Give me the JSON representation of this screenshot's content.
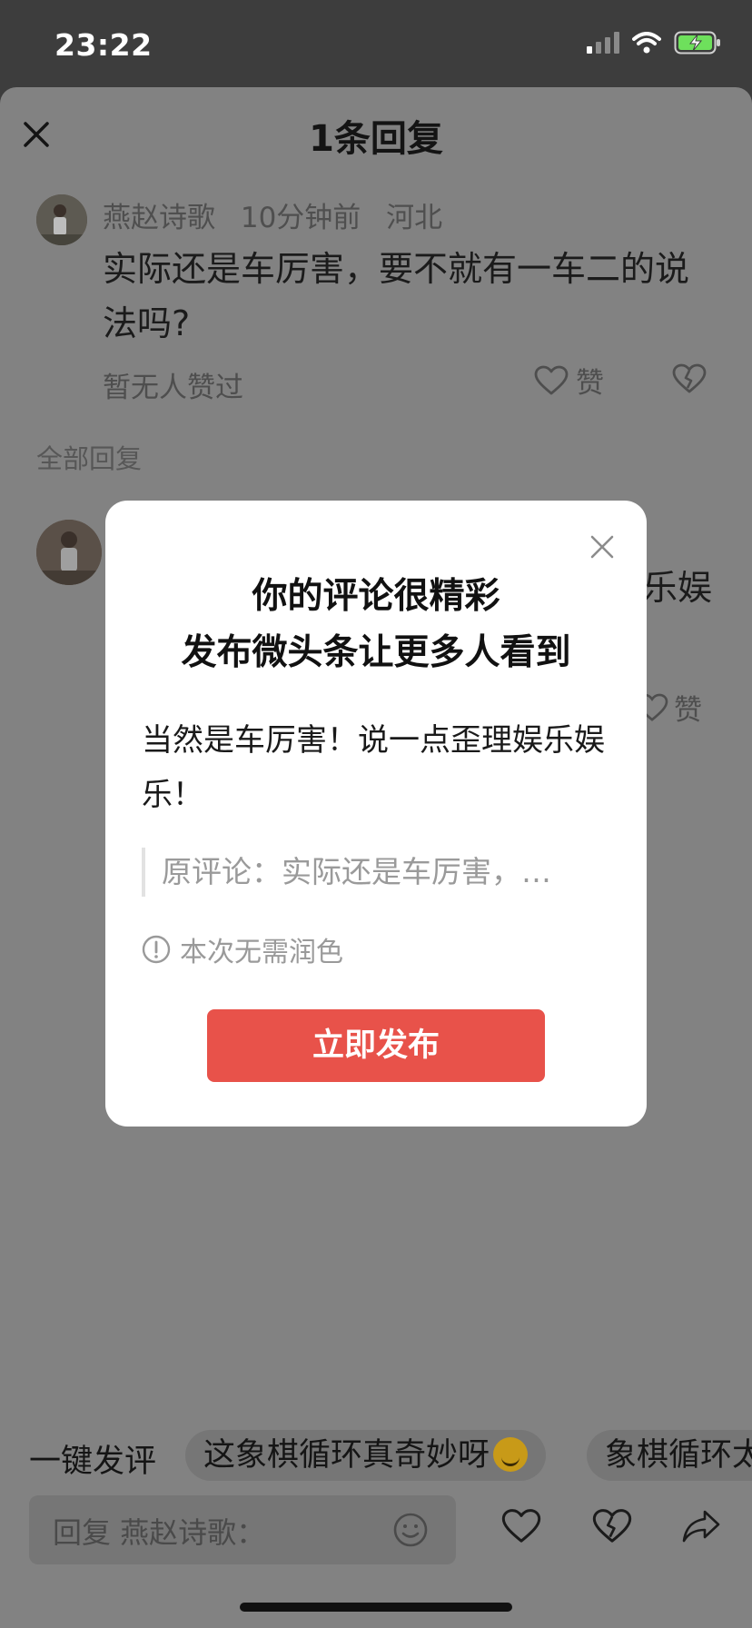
{
  "status_bar": {
    "time": "23:22",
    "battery_color": "#6ee05c"
  },
  "sheet": {
    "title": "1条回复",
    "comment": {
      "author": "燕赵诗歌",
      "time_ago": "10分钟前",
      "location": "河北",
      "text": "实际还是车厉害，要不就有一车二的说法吗?",
      "likes_text": "暂无人赞过",
      "like_label": "赞"
    },
    "all_replies_label": "全部回复",
    "reply_peek_text": "乐娱",
    "reply_like_label": "赞"
  },
  "modal": {
    "title_line1": "你的评论很精彩",
    "title_line2": "发布微头条让更多人看到",
    "body": "当然是车厉害！说一点歪理娱乐娱乐！",
    "quote": "原评论：实际还是车厉害，…",
    "hint": "本次无需润色",
    "publish_button": "立即发布",
    "accent": "#e8524a"
  },
  "quick_comments": {
    "label": "一键发评",
    "chips": [
      "这象棋循环真奇妙呀",
      "象棋循环太"
    ]
  },
  "reply_input": {
    "placeholder": "回复 燕赵诗歌："
  }
}
